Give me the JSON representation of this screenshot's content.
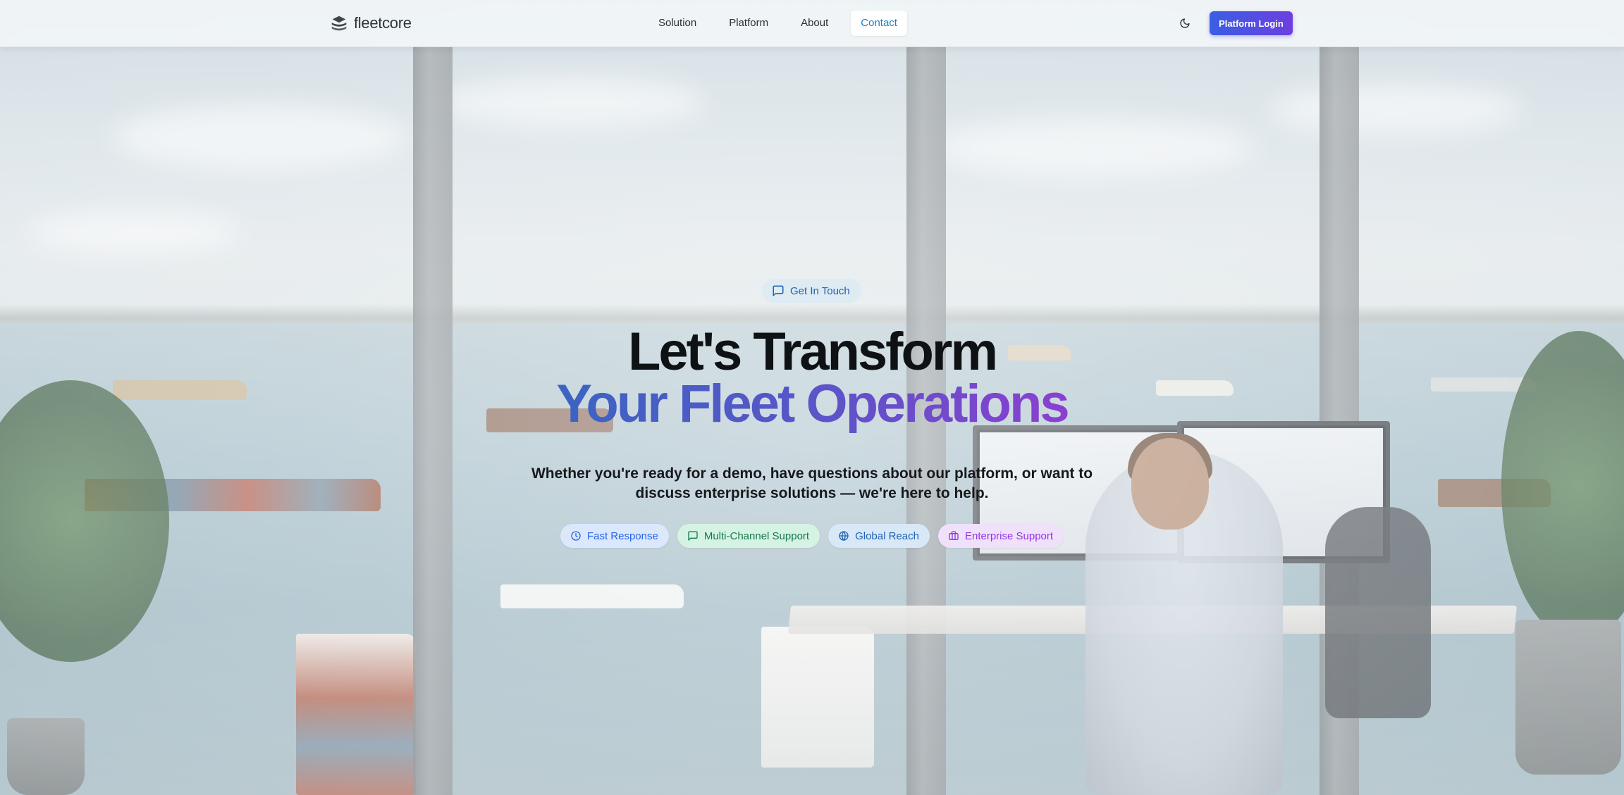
{
  "nav": {
    "brand": "fleetcore",
    "links": [
      {
        "label": "Solution"
      },
      {
        "label": "Platform"
      },
      {
        "label": "About"
      },
      {
        "label": "Contact",
        "active": true
      }
    ],
    "login_label": "Platform Login",
    "theme_icon": "moon-icon"
  },
  "hero": {
    "badge": {
      "label": "Get In Touch",
      "icon": "chat-icon"
    },
    "title_line1": "Let's Transform",
    "title_line2": "Your Fleet Operations",
    "subtitle": "Whether you're ready for a demo, have questions about our platform, or want to discuss enterprise solutions — we're here to help.",
    "features": [
      {
        "label": "Fast Response",
        "icon": "clock-icon",
        "color": "#2563eb",
        "bg": "#dbe8fb"
      },
      {
        "label": "Multi-Channel Support",
        "icon": "chat-icon",
        "color": "#16794b",
        "bg": "#d5f3e2"
      },
      {
        "label": "Global Reach",
        "icon": "globe-icon",
        "color": "#1e63b8",
        "bg": "#d8e8f6"
      },
      {
        "label": "Enterprise Support",
        "icon": "briefcase-icon",
        "color": "#9333ea",
        "bg": "#f0e1fb"
      }
    ]
  },
  "colors": {
    "accent_start": "#3a5ee4",
    "accent_end": "#6d3fe0",
    "active_link": "#1f7fbf"
  }
}
